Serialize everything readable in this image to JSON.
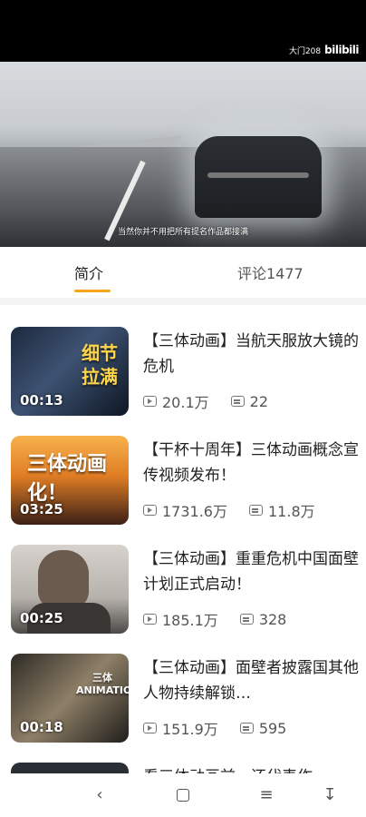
{
  "player": {
    "brand_text": "大门208",
    "brand_logo": "bilibili",
    "subtitle": "当然你并不用把所有提名作品都接满"
  },
  "tabs": [
    {
      "label": "简介",
      "active": true
    },
    {
      "label": "评论1477",
      "active": false
    }
  ],
  "videos": [
    {
      "title": "【三体动画】当航天服放大镜的危机",
      "duration": "00:13",
      "views": "20.1万",
      "danmaku": "22",
      "thumb_text": "细节拉满"
    },
    {
      "title": "【干杯十周年】三体动画概念宣传视频发布！",
      "duration": "03:25",
      "views": "1731.6万",
      "danmaku": "11.8万",
      "thumb_text": "三体动画化！"
    },
    {
      "title": "【三体动画】重重危机中国面壁计划正式启动！",
      "duration": "00:25",
      "views": "185.1万",
      "danmaku": "328",
      "thumb_text": ""
    },
    {
      "title": "【三体动画】面壁者披露国其他人物持续解锁…",
      "duration": "00:18",
      "views": "151.9万",
      "danmaku": "595",
      "thumb_text": "三体 ANIMATION"
    },
    {
      "title": "看三体动画前，还代表作",
      "duration": "",
      "views": "",
      "danmaku": "",
      "thumb_text": ""
    }
  ],
  "navbar": {
    "back_icon": "back-icon",
    "home_icon": "home-icon",
    "menu_icon": "menu-icon",
    "download_icon": "download-icon"
  }
}
